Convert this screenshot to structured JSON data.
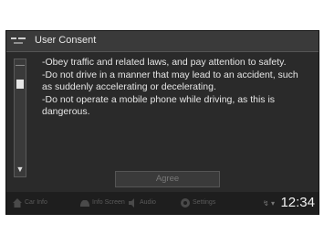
{
  "window": {
    "title": "User Consent"
  },
  "consent": {
    "lines": [
      "-Obey traffic and related laws, and pay attention to safety.",
      "-Do not drive in a manner that may lead to an accident, such as suddenly accelerating or decelerating.",
      "-Do not operate a mobile phone while driving, as this is dangerous."
    ],
    "agree_label": "Agree"
  },
  "nav": {
    "items": [
      {
        "icon": "home-icon",
        "label": "Car Info"
      },
      {
        "icon": "car-icon",
        "label": "Info Screen"
      },
      {
        "icon": "audio-icon",
        "label": "Audio"
      },
      {
        "icon": "settings-icon",
        "label": "Settings"
      }
    ]
  },
  "status": {
    "clock": "12:34",
    "icons": [
      "bluetooth-icon",
      "signal-icon"
    ]
  },
  "colors": {
    "background": "#2a2a2a",
    "text": "#e6e6e6",
    "clock": "#f0f0f0"
  }
}
